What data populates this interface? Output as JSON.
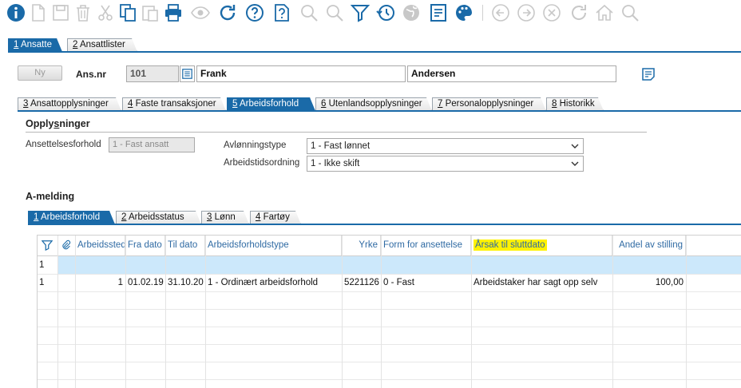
{
  "toolbar": {
    "icons": [
      "info-icon",
      "new-document-icon",
      "save-icon",
      "delete-icon",
      "cut-icon",
      "copy-icon",
      "paste-icon",
      "print-icon",
      "preview-icon",
      "refresh-icon",
      "help-icon",
      "document-help-icon",
      "search-icon",
      "filter-icon",
      "history-icon",
      "globe-icon",
      "notes-icon",
      "palette-icon",
      "back-icon",
      "forward-icon",
      "cancel-icon",
      "reload-icon",
      "home-icon",
      "zoom-icon"
    ]
  },
  "main_tabs": [
    {
      "key": "1",
      "label": " Ansatte"
    },
    {
      "key": "2",
      "label": " Ansattlister"
    }
  ],
  "header": {
    "ny_label": "Ny",
    "ans_nr_label": "Ans.nr",
    "ans_nr_value": "101",
    "first_name": "Frank",
    "last_name": "Andersen"
  },
  "sub_tabs": [
    {
      "key": "3",
      "label": " Ansattopplysninger"
    },
    {
      "key": "4",
      "label": " Faste transaksjoner"
    },
    {
      "key": "5",
      "label": " Arbeidsforhold"
    },
    {
      "key": "6",
      "label": " Utenlandsopplysninger"
    },
    {
      "key": "7",
      "label": " Personalopplysninger"
    },
    {
      "key": "8",
      "label": " Historikk"
    }
  ],
  "opplysninger": {
    "title_pre": "Opply",
    "title_key": "s",
    "title_post": "ninger",
    "ansettelsesforhold_label": "Ansettelsesforhold",
    "ansettelsesforhold_value": "1 - Fast ansatt",
    "avlonningstype_label": "Avlønningstype",
    "avlonningstype_value": "1 - Fast lønnet",
    "arbeidstidsordning_label": "Arbeidstidsordning",
    "arbeidstidsordning_value": "1 - Ikke skift"
  },
  "amelding": {
    "title": "A-melding",
    "tabs": [
      {
        "key": "1",
        "label": " Arbeidsforhold"
      },
      {
        "key": "2",
        "label": " Arbeidsstatus"
      },
      {
        "key": "3",
        "label": " Lønn"
      },
      {
        "key": "4",
        "label": " Fartøy"
      }
    ]
  },
  "grid": {
    "columns": [
      "Arbeidssted",
      "Fra dato",
      "Til dato",
      "Arbeidsforholdstype",
      "Yrke",
      "Form for ansettelse",
      "Årsak til sluttdato",
      "Andel av stilling"
    ],
    "filter_row_number": "1",
    "rows": [
      {
        "num": "1",
        "arbeidssted": "1",
        "fra": "01.02.19",
        "til": "31.10.20",
        "type": "1 - Ordinært arbeidsforhold",
        "yrke": "5221126",
        "form": "0 - Fast",
        "arsak": "Arbeidstaker har sagt opp selv",
        "andel": "100,00"
      }
    ]
  },
  "colors": {
    "accent": "#1a6aa8",
    "header_text": "#2f6aa3",
    "filter_row": "#cce8fb",
    "highlight": "#fff200"
  }
}
